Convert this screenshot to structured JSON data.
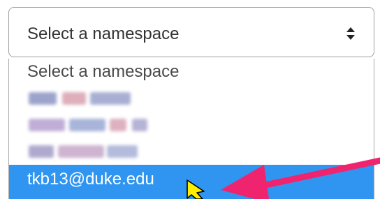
{
  "select": {
    "current_value": "Select a namespace",
    "icon": "updown-chevron-icon"
  },
  "dropdown": {
    "options": [
      {
        "label": "Select a namespace",
        "state": "placeholder"
      },
      {
        "label": "",
        "state": "redacted"
      },
      {
        "label": "",
        "state": "redacted"
      },
      {
        "label": "",
        "state": "redacted"
      },
      {
        "label": "tkb13@duke.edu",
        "state": "highlighted"
      }
    ]
  },
  "annotation": {
    "arrow_color": "#f0246e",
    "highlight_color": "#2f95f0"
  },
  "cursor": {
    "icon": "mouse-pointer-icon"
  }
}
